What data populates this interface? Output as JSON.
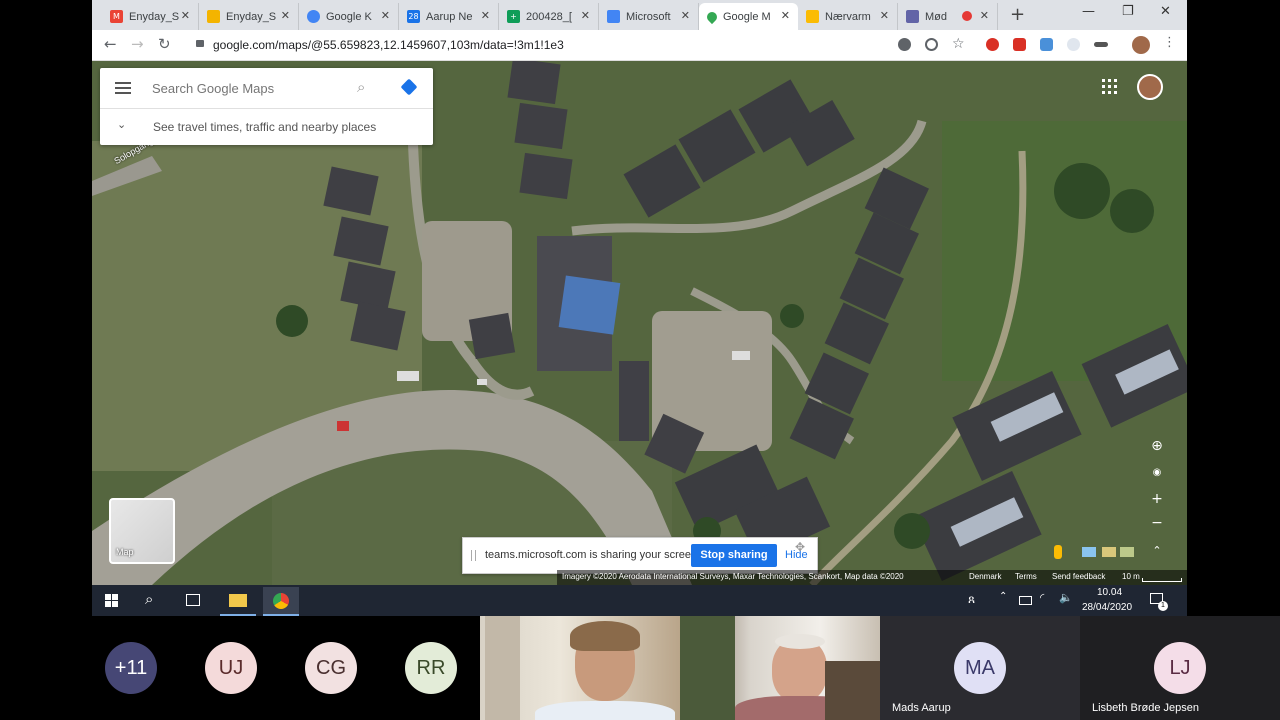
{
  "browser": {
    "tabs": [
      {
        "title": "Enyday_S",
        "icon": "gmail-icon",
        "color": "#ea4335",
        "glyph": "M"
      },
      {
        "title": "Enyday_S",
        "icon": "slides-icon",
        "color": "#f4b400",
        "glyph": ""
      },
      {
        "title": "Google K",
        "icon": "google-account-icon",
        "color": "#4285f4",
        "glyph": ""
      },
      {
        "title": "Aarup Ne",
        "icon": "calendar-icon",
        "color": "#1a73e8",
        "glyph": "28"
      },
      {
        "title": "200428_[",
        "icon": "sheets-icon",
        "color": "#0f9d58",
        "glyph": "+"
      },
      {
        "title": "Microsoft",
        "icon": "docs-icon",
        "color": "#4285f4",
        "glyph": ""
      },
      {
        "title": "Google M",
        "icon": "maps-icon",
        "color": "#34a853",
        "glyph": ""
      },
      {
        "title": "Nærvarm",
        "icon": "drive-icon",
        "color": "#fbbc04",
        "glyph": ""
      },
      {
        "title": "Mød",
        "icon": "teams-icon",
        "color": "#6264a7",
        "glyph": ""
      }
    ],
    "active_tab": 6,
    "url": "google.com/maps/@55.659823,12.1459607,103m/data=!3m1!1e3"
  },
  "maps": {
    "search_placeholder": "Search Google Maps",
    "travel_hint": "See travel times, traffic and nearby places",
    "street_label": "Solopgang",
    "layer_label": "Map",
    "footer": {
      "attribution": "Imagery ©2020 Aerodata International Surveys, Maxar Technologies, Scankort, Map data ©2020",
      "country": "Denmark",
      "terms": "Terms",
      "feedback": "Send feedback",
      "scale": "10 m"
    }
  },
  "share_bar": {
    "message": "teams.microsoft.com is sharing your screen.",
    "stop_label": "Stop sharing",
    "hide_label": "Hide"
  },
  "taskbar": {
    "time": "10.04",
    "date": "28/04/2020",
    "notification_count": "1"
  },
  "participants": [
    {
      "initials": "+11",
      "bg": "#464775",
      "fg": "#ffffff"
    },
    {
      "initials": "UJ",
      "bg": "#f4dada",
      "fg": "#5a2b2b"
    },
    {
      "initials": "CG",
      "bg": "#f2e1e1",
      "fg": "#4a3030"
    },
    {
      "initials": "RR",
      "bg": "#e3ecd8",
      "fg": "#3a4a2a"
    }
  ],
  "video_tiles": [
    {
      "name": ""
    },
    {
      "name": ""
    }
  ],
  "named_participants": [
    {
      "initials": "MA",
      "name": "Mads Aarup",
      "bg": "#e0e0f5",
      "fg": "#3b3a6a"
    },
    {
      "initials": "LJ",
      "name": "Lisbeth Brøde Jepsen",
      "bg": "#f4dde8",
      "fg": "#5a2b43"
    }
  ]
}
